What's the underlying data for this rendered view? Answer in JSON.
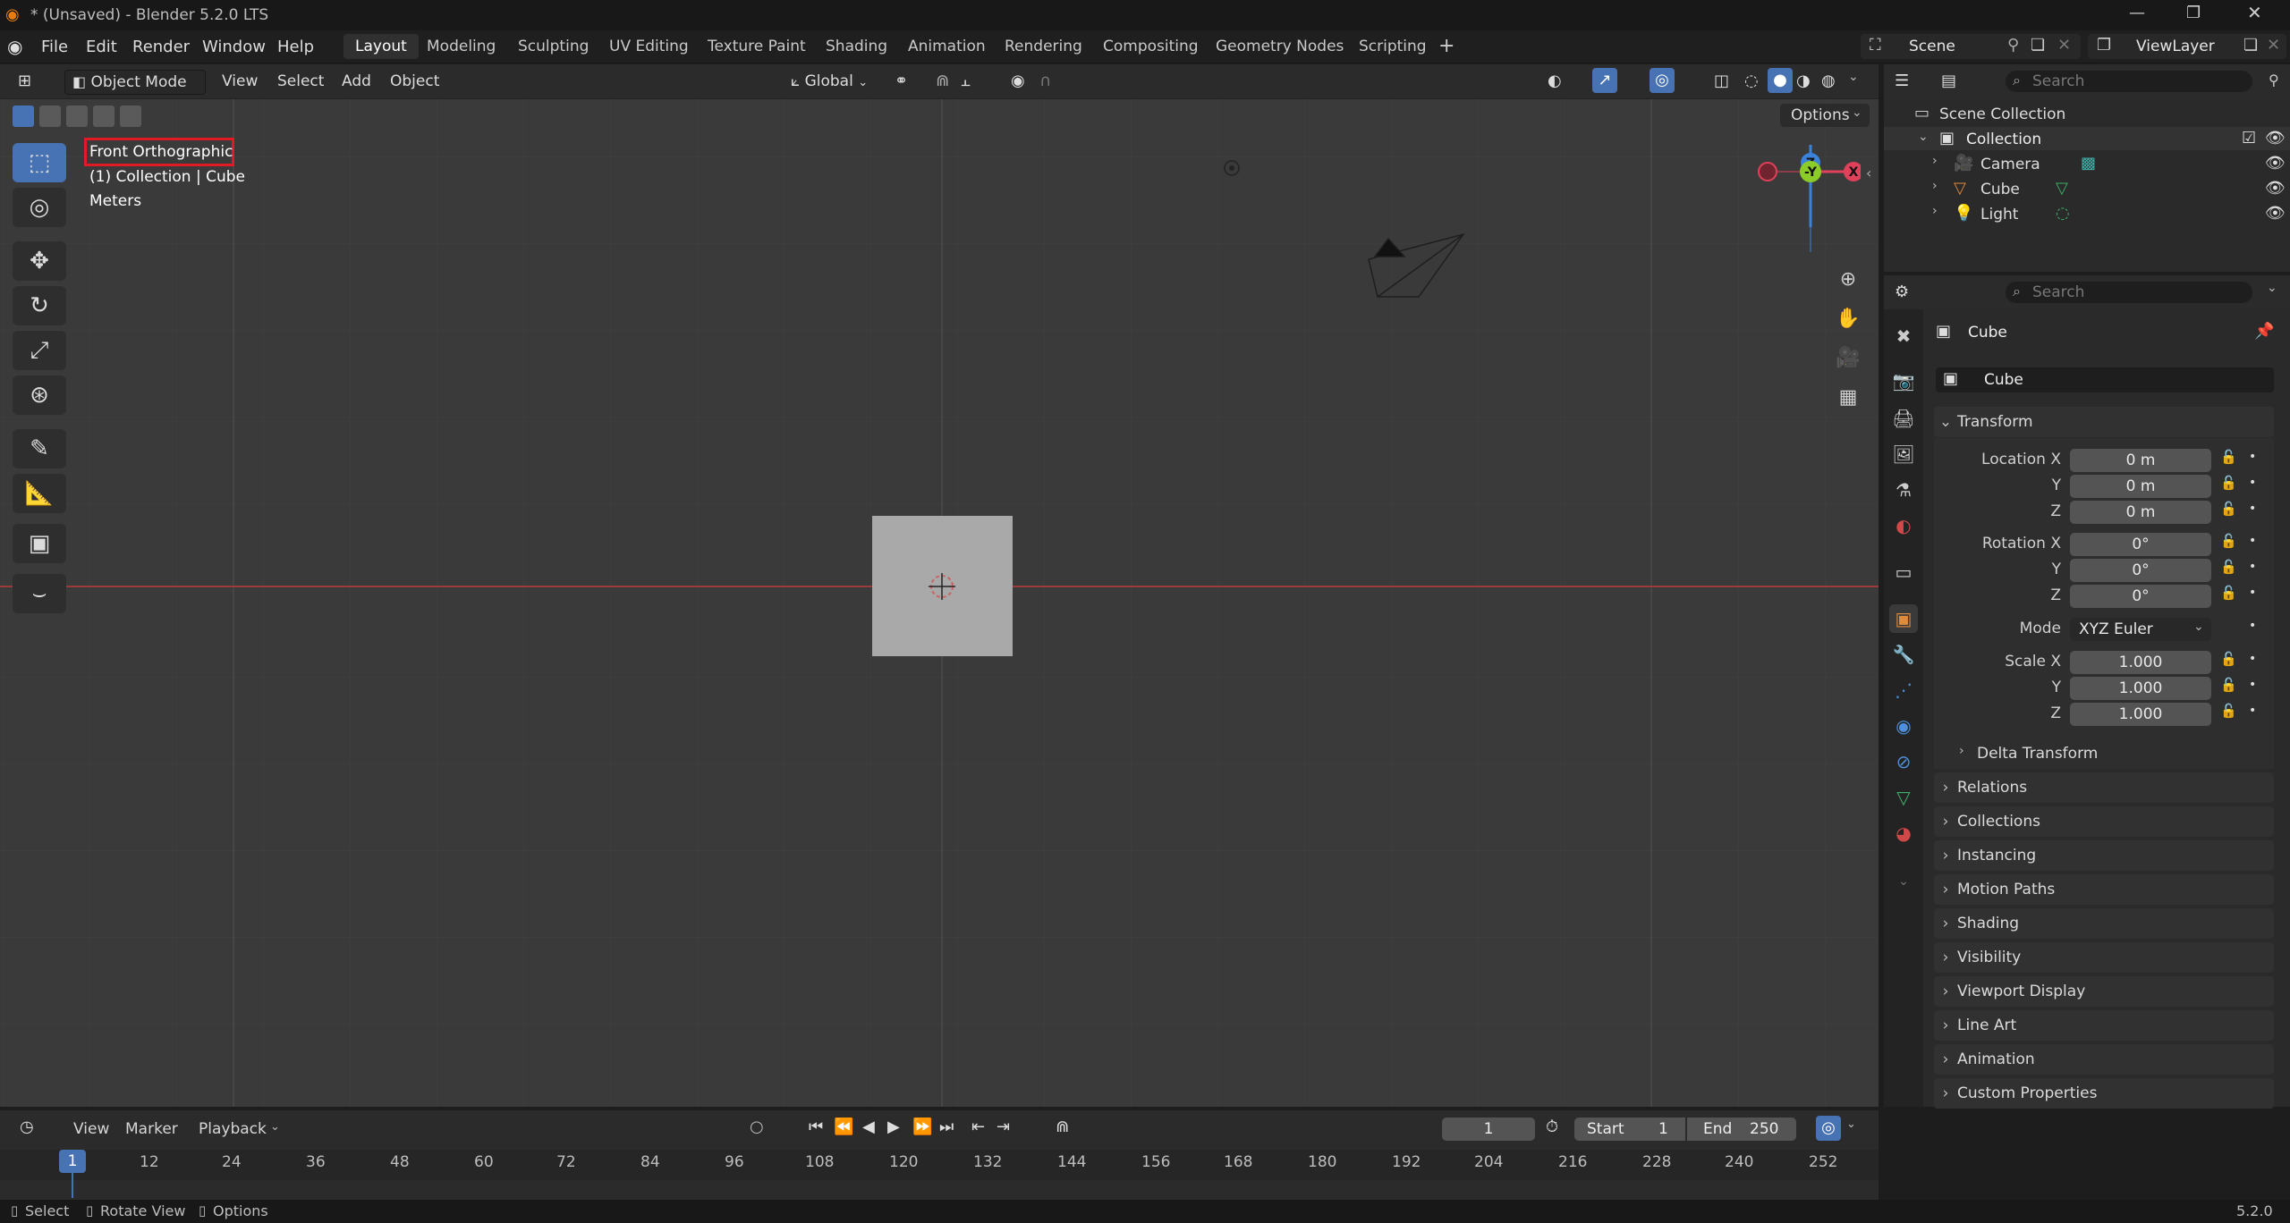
{
  "window": {
    "title": "* (Unsaved) - Blender 5.2.0 LTS",
    "version": "5.2.0"
  },
  "menu": {
    "items": [
      "File",
      "Edit",
      "Render",
      "Window",
      "Help"
    ]
  },
  "workspaces": {
    "tabs": [
      "Layout",
      "Modeling",
      "Sculpting",
      "UV Editing",
      "Texture Paint",
      "Shading",
      "Animation",
      "Rendering",
      "Compositing",
      "Geometry Nodes",
      "Scripting"
    ],
    "active": "Layout",
    "add": "+"
  },
  "scene": {
    "name": "Scene",
    "view_layer": "ViewLayer"
  },
  "viewport_header": {
    "mode": "Object Mode",
    "menus": [
      "View",
      "Select",
      "Add",
      "Object"
    ],
    "orientation": "Global",
    "options_label": "Options"
  },
  "viewport_overlay": {
    "view_name": "Front Orthographic",
    "collection_line": "(1) Collection | Cube",
    "units": "Meters"
  },
  "gizmo": {
    "z": "Z",
    "y": "-Y",
    "x": "X"
  },
  "outliner": {
    "search_placeholder": "Search",
    "root": "Scene Collection",
    "collection": "Collection",
    "items": [
      "Camera",
      "Cube",
      "Light"
    ]
  },
  "properties": {
    "search_placeholder": "Search",
    "object_name": "Cube",
    "data_name": "Cube",
    "transform": {
      "title": "Transform",
      "location_label": "Location X",
      "location": [
        "0 m",
        "0 m",
        "0 m"
      ],
      "rotation_label": "Rotation X",
      "rotation": [
        "0°",
        "0°",
        "0°"
      ],
      "mode_label": "Mode",
      "mode_value": "XYZ Euler",
      "scale_label": "Scale X",
      "scale": [
        "1.000",
        "1.000",
        "1.000"
      ],
      "axis_y": "Y",
      "axis_z": "Z",
      "delta": "Delta Transform"
    },
    "panels": [
      "Relations",
      "Collections",
      "Instancing",
      "Motion Paths",
      "Shading",
      "Visibility",
      "Viewport Display",
      "Line Art",
      "Animation",
      "Custom Properties"
    ]
  },
  "timeline": {
    "menus": [
      "View",
      "Marker",
      "Playback"
    ],
    "current_frame": "1",
    "start_label": "Start",
    "start": "1",
    "end_label": "End",
    "end": "250",
    "ruler": [
      "12",
      "24",
      "36",
      "48",
      "60",
      "72",
      "84",
      "96",
      "108",
      "120",
      "132",
      "144",
      "156",
      "168",
      "180",
      "192",
      "204",
      "216",
      "228",
      "240",
      "252"
    ]
  },
  "statusbar": {
    "select": "Select",
    "rotate": "Rotate View",
    "options": "Options"
  },
  "colors": {
    "accent": "#4772b3",
    "x_axis": "#e0415a",
    "y_axis": "#8bcc28",
    "z_axis": "#3b82db",
    "highlight_box": "#e01b24"
  }
}
